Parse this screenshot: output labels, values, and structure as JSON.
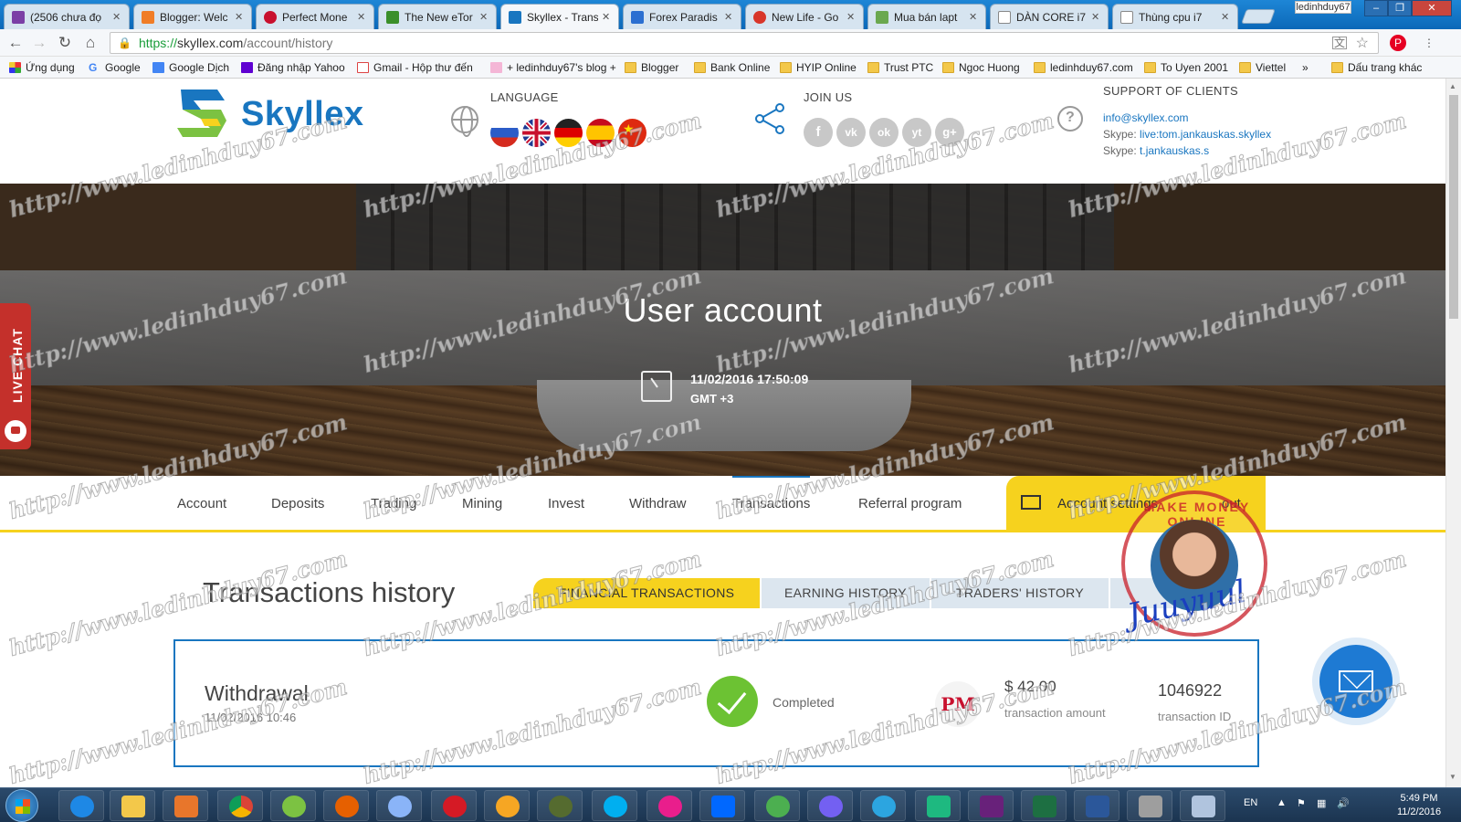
{
  "browser": {
    "tabs": [
      {
        "label": "(2506 chưa đọ",
        "color": "#7b3fa6"
      },
      {
        "label": "Blogger: Welc",
        "color": "#f07d27"
      },
      {
        "label": "Perfect Mone",
        "color": "#c8102e"
      },
      {
        "label": "The New eTor",
        "color": "#3a8f2a"
      },
      {
        "label": "Skyllex - Trans",
        "color": "#1976c0"
      },
      {
        "label": "Forex Paradis",
        "color": "#2b6fd1"
      },
      {
        "label": "New Life - Go",
        "color": "#d8362a"
      },
      {
        "label": "Mua bán lapt",
        "color": "#6aa84f"
      },
      {
        "label": "DÀN CORE i7",
        "color": "#ffffff"
      },
      {
        "label": "Thùng cpu i7",
        "color": "#ffffff"
      }
    ],
    "profile_name": "ledinhduy67",
    "url": {
      "scheme": "https://",
      "domain": "skyllex.com",
      "path": "/account/history"
    },
    "bookmarks": [
      {
        "label": "Ứng dụng",
        "icon": "apps-grid-icon"
      },
      {
        "label": "Google",
        "icon": "google-icon"
      },
      {
        "label": "Google Dịch",
        "icon": "translate-icon"
      },
      {
        "label": "Đăng nhập Yahoo",
        "icon": "yahoo-icon"
      },
      {
        "label": "Gmail - Hộp thư đến",
        "icon": "gmail-icon"
      },
      {
        "label": "+ ledinhduy67's blog +",
        "icon": "blog-icon"
      },
      {
        "label": "Blogger",
        "icon": "folder-icon"
      },
      {
        "label": "Bank Online",
        "icon": "folder-icon"
      },
      {
        "label": "HYIP Online",
        "icon": "folder-icon"
      },
      {
        "label": "Trust PTC",
        "icon": "folder-icon"
      },
      {
        "label": "Ngoc Huong",
        "icon": "folder-icon"
      },
      {
        "label": "ledinhduy67.com",
        "icon": "folder-icon"
      },
      {
        "label": "To Uyen 2001",
        "icon": "folder-icon"
      },
      {
        "label": "Viettel",
        "icon": "folder-icon"
      },
      {
        "label": "»",
        "icon": ""
      },
      {
        "label": "Dấu trang khác",
        "icon": "folder-icon"
      }
    ]
  },
  "header": {
    "brand": "Skyllex",
    "language_label": "LANGUAGE",
    "join_label": "JOIN US",
    "support_label": "SUPPORT OF CLIENTS",
    "support_email": "info@skyllex.com",
    "skype_prefix": "Skype:",
    "skype_1": "live:tom.jankauskas.skyllex",
    "skype_2": "t.jankauskas.s",
    "social": [
      "f",
      "vk",
      "ok",
      "yt",
      "g+"
    ]
  },
  "hero": {
    "title": "User account",
    "datetime": "11/02/2016 17:50:09",
    "timezone": "GMT +3"
  },
  "livechat": {
    "label": "LIVE CHAT"
  },
  "nav": {
    "items": [
      "Account",
      "Deposits",
      "Trading",
      "Mining",
      "Invest",
      "Withdraw",
      "Transactions",
      "Referral program"
    ],
    "account_settings": "Account settings",
    "logout": "out"
  },
  "history": {
    "title": "Transactions history",
    "tabs": [
      "FINANCIAL TRANSACTIONS",
      "EARNING HISTORY",
      "TRADERS' HISTORY"
    ],
    "transaction": {
      "type": "Withdrawal",
      "date": "11/02/2016 10:46",
      "status": "Completed",
      "system": "PM",
      "amount": "$ 42.00",
      "amount_label": "transaction amount",
      "id": "1046922",
      "id_label": "transaction ID"
    }
  },
  "overlay": {
    "watermark": "http://www.ledinhduy67.com",
    "stamp_text": "MAKE MONEY ONLINE",
    "signature": "Juuyuul"
  },
  "taskbar": {
    "language": "EN",
    "time": "5:49 PM",
    "date": "11/2/2016"
  },
  "colors": {
    "brand_blue": "#1976c0",
    "accent_yellow": "#f6d21e",
    "success_green": "#6cc233",
    "livechat_red": "#c4302b"
  }
}
